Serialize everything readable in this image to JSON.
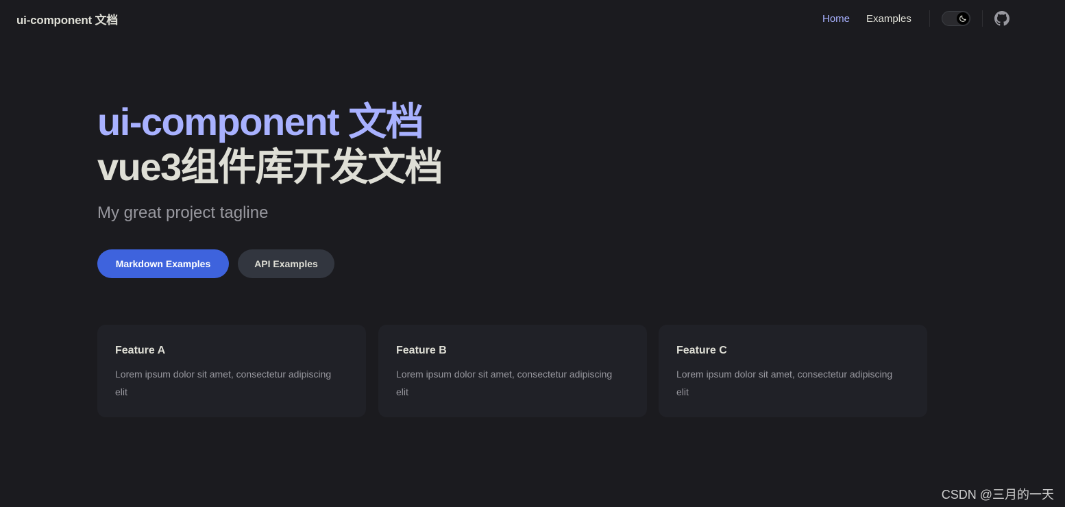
{
  "nav": {
    "site_title": "ui-component 文档",
    "links": [
      {
        "label": "Home",
        "active": true
      },
      {
        "label": "Examples",
        "active": false
      }
    ],
    "appearance_icon": "moon-icon",
    "social_icon": "github-icon"
  },
  "hero": {
    "name": "ui-component 文档",
    "text": "vue3组件库开发文档",
    "tagline": "My great project tagline",
    "actions": [
      {
        "label": "Markdown Examples",
        "theme": "brand"
      },
      {
        "label": "API Examples",
        "theme": "alt"
      }
    ]
  },
  "features": [
    {
      "title": "Feature A",
      "details": "Lorem ipsum dolor sit amet, consectetur adipiscing elit"
    },
    {
      "title": "Feature B",
      "details": "Lorem ipsum dolor sit amet, consectetur adipiscing elit"
    },
    {
      "title": "Feature C",
      "details": "Lorem ipsum dolor sit amet, consectetur adipiscing elit"
    }
  ],
  "watermark": "CSDN @三月的一天",
  "colors": {
    "background": "#1b1b1f",
    "brand": "#a8b1ff",
    "brand_button": "#3e63dd",
    "alt_button": "#32363f",
    "feature_card": "#202127",
    "text_primary": "#dfdfd6",
    "text_secondary": "#98989f"
  }
}
